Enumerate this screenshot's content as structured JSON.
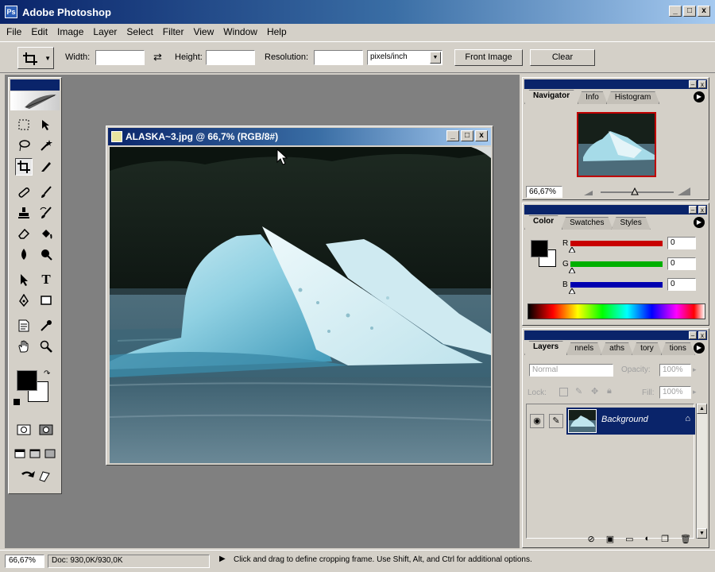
{
  "app": {
    "title": "Adobe Photoshop"
  },
  "window_controls": {
    "minimize": "_",
    "maximize": "□",
    "close": "x"
  },
  "menu": [
    "File",
    "Edit",
    "Image",
    "Layer",
    "Select",
    "Filter",
    "View",
    "Window",
    "Help"
  ],
  "options_bar": {
    "width_label": "Width:",
    "width_value": "",
    "height_label": "Height:",
    "height_value": "",
    "resolution_label": "Resolution:",
    "resolution_value": "",
    "resolution_unit": "pixels/inch",
    "front_image_label": "Front Image",
    "clear_label": "Clear"
  },
  "document": {
    "title": "ALASKA~3.jpg @ 66,7% (RGB/8#)"
  },
  "navigator": {
    "tabs": [
      "Navigator",
      "Info",
      "Histogram"
    ],
    "zoom": "66,67%"
  },
  "color": {
    "tabs": [
      "Color",
      "Swatches",
      "Styles"
    ],
    "channels": [
      {
        "label": "R",
        "value": "0",
        "color": "#c80000"
      },
      {
        "label": "G",
        "value": "0",
        "color": "#00b000"
      },
      {
        "label": "B",
        "value": "0",
        "color": "#0000b0"
      }
    ]
  },
  "layers": {
    "tabs": [
      "Layers",
      "nnels",
      "aths",
      "tory",
      "tions"
    ],
    "blend_mode": "Normal",
    "opacity_label": "Opacity:",
    "opacity_value": "100%",
    "lock_label": "Lock:",
    "fill_label": "Fill:",
    "fill_value": "100%",
    "layer_name": "Background"
  },
  "status": {
    "zoom": "66,67%",
    "doc": "Doc: 930,0K/930,0K",
    "hint": "Click and drag to define cropping frame. Use Shift, Alt, and Ctrl for additional options."
  },
  "colors": {
    "titlebar_dark": "#0a246a",
    "chrome": "#d4d0c8",
    "workspace": "#808080",
    "layer_selected": "#0a246a"
  }
}
